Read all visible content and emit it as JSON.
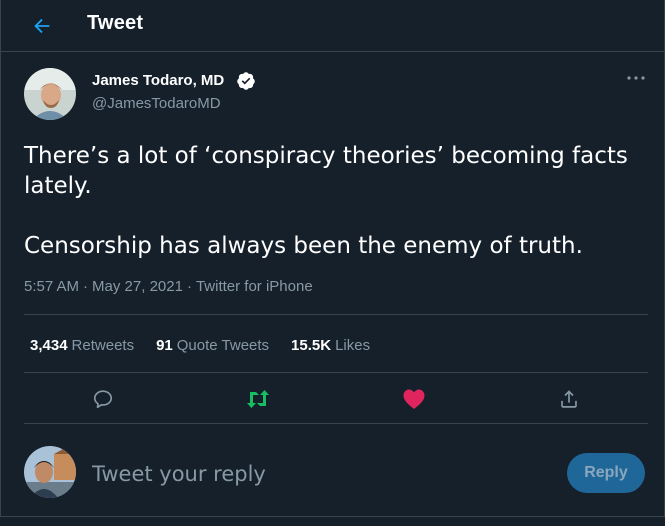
{
  "header": {
    "title": "Tweet",
    "back_icon": "arrow-left-icon"
  },
  "tweet": {
    "author": {
      "name": "James Todaro, MD",
      "handle": "@JamesTodaroMD",
      "verified": true
    },
    "text": [
      "There’s a lot of ‘conspiracy theories’ becoming facts lately.",
      "Censorship has always been the enemy of truth."
    ],
    "time": "5:57 AM",
    "date": "May 27, 2021",
    "source": "Twitter for iPhone",
    "more_icon": "more-dots-icon"
  },
  "stats": {
    "retweets_count": "3,434",
    "retweets_label": "Retweets",
    "quotes_count": "91",
    "quotes_label": "Quote Tweets",
    "likes_count": "15.5K",
    "likes_label": "Likes"
  },
  "actions": [
    {
      "icon": "reply-icon",
      "liked": false
    },
    {
      "icon": "retweet-icon",
      "active": true
    },
    {
      "icon": "heart-icon",
      "liked": true
    },
    {
      "icon": "share-icon"
    }
  ],
  "reply": {
    "placeholder": "Tweet your reply",
    "button_label": "Reply"
  },
  "colors": {
    "background": "#15202b",
    "border": "#38444d",
    "accent": "#1da1f2",
    "secondary_text": "#8899a6",
    "retweet_green": "#17bf63",
    "like_pink": "#e0245e"
  }
}
